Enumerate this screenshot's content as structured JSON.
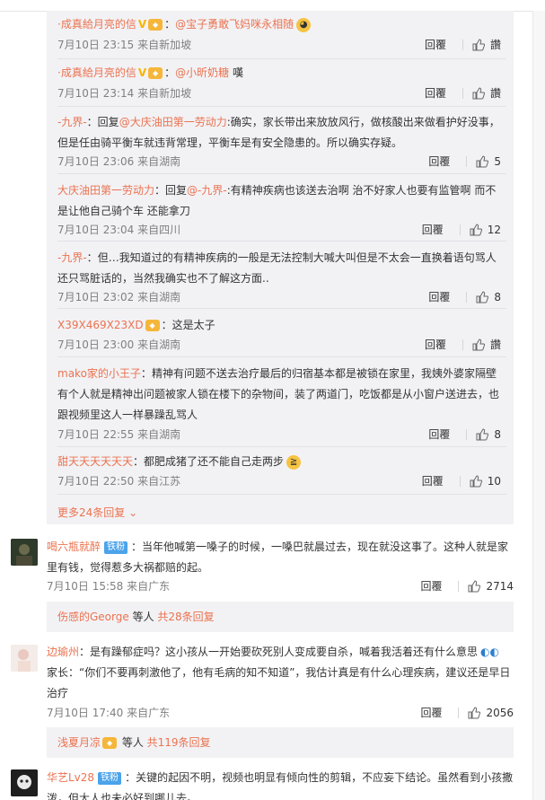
{
  "sub_comments": [
    {
      "user": "·成真給月亮的信",
      "badge": "V",
      "text_prefix": "：",
      "mention": "@宝子勇敢飞妈咪永相随",
      "text": "",
      "emoji": "grin-emoji",
      "time": "7月10日 23:15",
      "from": "来自新加坡",
      "reply": "回覆",
      "likes": "讚"
    },
    {
      "user": "·成真給月亮的信",
      "badge": "V",
      "text_prefix": "：",
      "mention": "@小昕奶糖",
      "text": " 嘆",
      "time": "7月10日 23:14",
      "from": "来自新加坡",
      "reply": "回覆",
      "likes": "讚"
    },
    {
      "user": "-九界-",
      "text_prefix": "：回复",
      "mention": "@大庆油田第一劳动力",
      "text": ":确实，家长带出来放放风行，做核酸出来做看护好没事，但是任由骑平衡车就违背常理，平衡车是有安全隐患的。所以确实存疑。",
      "time": "7月10日 23:06",
      "from": "来自湖南",
      "reply": "回覆",
      "likes": "5"
    },
    {
      "user": "大庆油田第一劳动力",
      "text_prefix": "：回复",
      "mention": "@-九界-",
      "text": ":有精神疾病也该送去治啊 治不好家人也要有监管啊 而不是让他自己骑个车 还能拿刀",
      "time": "7月10日 23:04",
      "from": "来自四川",
      "reply": "回覆",
      "likes": "12"
    },
    {
      "user": "-九界-",
      "text_prefix": "：",
      "text": "但…我知道过的有精神疾病的一般是无法控制大喊大叫但是不太会一直换着语句骂人还只骂脏话的，当然我确实也不了解这方面..",
      "time": "7月10日 23:02",
      "from": "来自湖南",
      "reply": "回覆",
      "likes": "8"
    },
    {
      "user": "X39X469X23XD",
      "text_prefix": "：",
      "text": "这是太子",
      "time": "7月10日 23:00",
      "from": "来自湖南",
      "reply": "回覆",
      "likes": "讚"
    },
    {
      "user": "mako家的小王子",
      "text_prefix": "：",
      "text": "精神有问题不送去治疗最后的归宿基本都是被锁在家里，我姨外婆家隔壁有个人就是精神出问题被家人锁在楼下的杂物间，装了两道门，吃饭都是从小窗户送进去，也跟视频里这人一样暴躁乱骂人",
      "time": "7月10日 22:55",
      "from": "来自湖南",
      "reply": "回覆",
      "likes": "8"
    },
    {
      "user": "甜天天天天天天",
      "text_prefix": "：",
      "text": "都肥成猪了还不能自己走两步",
      "emoji": "cry-emoji",
      "time": "7月10日 22:50",
      "from": "来自江苏",
      "reply": "回覆",
      "likes": "10"
    }
  ],
  "more_replies": "更多24条回复",
  "main_comments": [
    {
      "user": "喝六瓶就醉",
      "fan": "铁粉",
      "text": "：当年他喊第一嗓子的时候，一嗓巴就晨过去，现在就没这事了。这种人就是家里有钱，觉得惹多大祸都赔的起。",
      "time": "7月10日 15:58",
      "from": "来自广东",
      "reply": "回覆",
      "likes": "2714",
      "summary_user": "伤感的George",
      "summary_tail": " 等人 ",
      "summary_count": "共28条回复"
    },
    {
      "user": "边瑜州",
      "text": "：是有躁郁症吗？这小孩从一开始要砍死别人变成要自杀，喊着我活着还有什么意思",
      "text2": "家长：“你们不要再刺激他了，他有毛病的知不知道”，我估计真是有什么心理疾病，建议还是早日治疗",
      "time": "7月10日 17:40",
      "from": "来自广东",
      "reply": "回覆",
      "likes": "2056",
      "summary_user": "浅夏月凉",
      "summary_tail": " 等人 ",
      "summary_count": "共119条回复"
    },
    {
      "user": "华艺Lv28",
      "fan": "铁粉",
      "text": "：关键的起因不明，视频也明显有倾向性的剪辑，不应妄下结论。虽然看到小孩撒泼，但大人也未必好到哪儿去。"
    }
  ],
  "colors": {
    "accent": "#eb7350",
    "panel": "#f2f2f5",
    "meta": "#808080"
  }
}
